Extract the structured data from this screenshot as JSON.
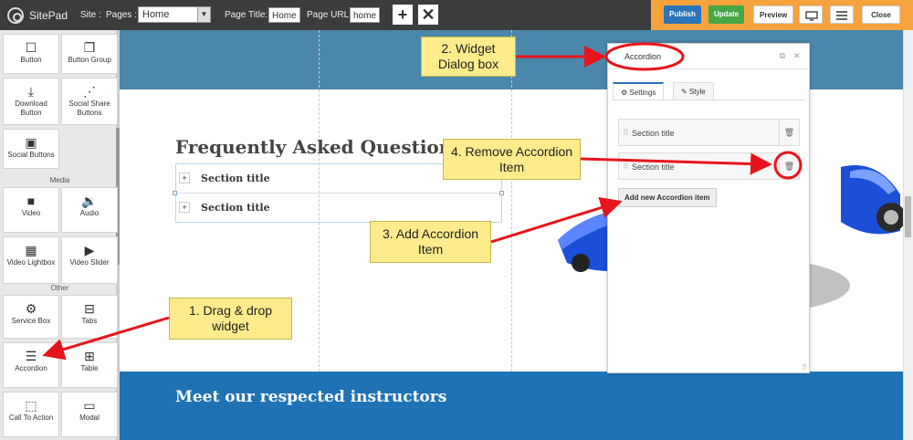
{
  "topbar": {
    "brand": "SitePad",
    "site_label": "Site :",
    "pages_label": "Pages :",
    "pages_value": "Home",
    "page_title_label": "Page Title:",
    "page_title_value": "Home",
    "page_url_label": "Page URL:",
    "page_url_value": "home",
    "add_icon": "plus-icon",
    "delete_icon": "x-icon",
    "publish": "Publish",
    "update": "Update",
    "preview": "Preview",
    "close": "Close",
    "colors": {
      "bar": "#3c3c3c",
      "orange": "#f6a23d",
      "publish": "#2a74b8",
      "update": "#45a745"
    }
  },
  "sidebar": {
    "widgets": [
      {
        "label": "Button",
        "icon": "square-icon"
      },
      {
        "label": "Button Group",
        "icon": "copy-icon"
      },
      {
        "label": "Download Button",
        "icon": "download-icon"
      },
      {
        "label": "Social Share Buttons",
        "icon": "share-icon"
      },
      {
        "label": "Social Buttons",
        "icon": "social-icon"
      }
    ],
    "media_label": "Media",
    "media": [
      {
        "label": "Video",
        "icon": "video-icon"
      },
      {
        "label": "Audio",
        "icon": "audio-icon"
      },
      {
        "label": "Video Lightbox",
        "icon": "film-icon"
      },
      {
        "label": "Video Slider",
        "icon": "video-slider-icon"
      }
    ],
    "other_label": "Other",
    "other": [
      {
        "label": "Service Box",
        "icon": "gear-icon"
      },
      {
        "label": "Tabs",
        "icon": "tabs-icon"
      },
      {
        "label": "Accordion",
        "icon": "accordion-icon"
      },
      {
        "label": "Table",
        "icon": "table-icon"
      },
      {
        "label": "Call To Action",
        "icon": "cursor-icon"
      },
      {
        "label": "Modal",
        "icon": "modal-icon"
      }
    ]
  },
  "canvas": {
    "faq_title": "Frequently Asked Question",
    "accordion_items": [
      "Section title",
      "Section title"
    ],
    "accordion_toggle": "+",
    "bottom_heading": "Meet our respected instructors"
  },
  "dialog": {
    "title": "Accordion",
    "tab_settings": "Settings",
    "tab_style": "Style",
    "items": [
      "Section title",
      "Section title"
    ],
    "add_button": "Add new Accordion item"
  },
  "callouts": {
    "drag": "1. Drag & drop widget",
    "dialog": "2. Widget Dialog box",
    "add": "3. Add Accordion Item",
    "remove": "4. Remove Accordion Item"
  }
}
